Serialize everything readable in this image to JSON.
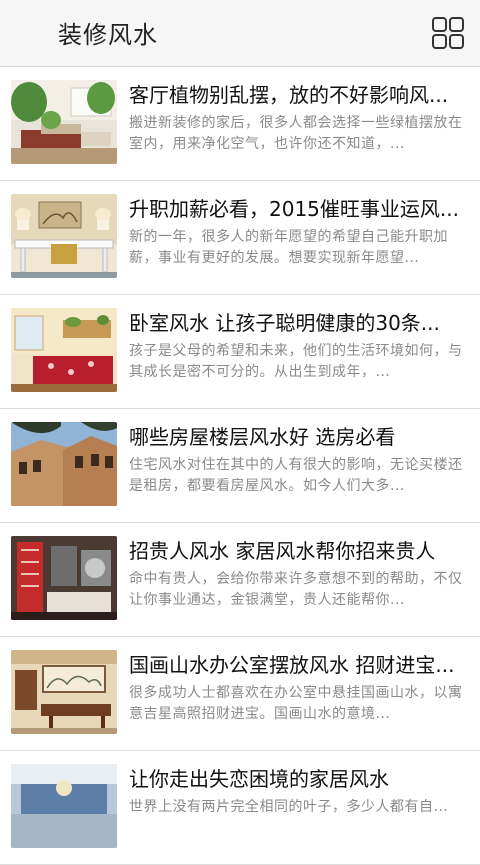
{
  "header": {
    "title": "装修风水",
    "menu_icon": "grid-menu-icon"
  },
  "articles": [
    {
      "title": "客厅植物别乱摆，放的不好影响风...",
      "desc": "搬进新装修的家后，很多人都会选择一些绿植摆放在室内，用来净化空气，也许你还不知道，..."
    },
    {
      "title": "升职加薪必看，2015催旺事业运风...",
      "desc": "新的一年，很多人的新年愿望的希望自己能升职加薪，事业有更好的发展。想要实现新年愿望..."
    },
    {
      "title": "卧室风水 让孩子聪明健康的30条...",
      "desc": "孩子是父母的希望和未来，他们的生活环境如何，与其成长是密不可分的。从出生到成年，..."
    },
    {
      "title": "哪些房屋楼层风水好 选房必看",
      "desc": "住宅风水对住在其中的人有很大的影响，无论买楼还是租房，都要看房屋风水。如今人们大多..."
    },
    {
      "title": "招贵人风水 家居风水帮你招来贵人",
      "desc": "命中有贵人，会给你带来许多意想不到的帮助，不仅让你事业通达，金银满堂，贵人还能帮你..."
    },
    {
      "title": "国画山水办公室摆放风水 招财进宝...",
      "desc": "很多成功人士都喜欢在办公室中悬挂国画山水，以寓意吉星高照招财进宝。国画山水的意境..."
    },
    {
      "title": "让你走出失恋困境的家居风水",
      "desc": "世界上没有两片完全相同的叶子，多少人都有自..."
    }
  ]
}
